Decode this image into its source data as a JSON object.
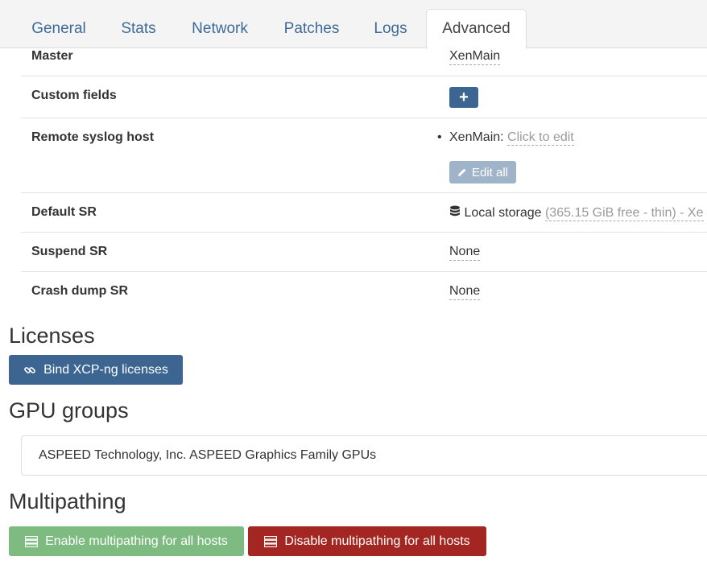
{
  "tabs": [
    {
      "label": "General"
    },
    {
      "label": "Stats"
    },
    {
      "label": "Network"
    },
    {
      "label": "Patches"
    },
    {
      "label": "Logs"
    },
    {
      "label": "Advanced",
      "active": true
    }
  ],
  "properties": {
    "master": {
      "label": "Master",
      "value": "XenMain"
    },
    "custom_fields": {
      "label": "Custom fields",
      "add_button": "+"
    },
    "remote_syslog": {
      "label": "Remote syslog host",
      "host": "XenMain:",
      "edit_link": "Click to edit",
      "edit_all_button": "Edit all"
    },
    "default_sr": {
      "label": "Default SR",
      "name": "Local storage",
      "detail": "(365.15 GiB free - thin) - Xe"
    },
    "suspend_sr": {
      "label": "Suspend SR",
      "value": "None"
    },
    "crash_dump_sr": {
      "label": "Crash dump SR",
      "value": "None"
    }
  },
  "licenses": {
    "title": "Licenses",
    "bind_button": "Bind XCP-ng licenses"
  },
  "gpu_groups": {
    "title": "GPU groups",
    "items": [
      "ASPEED Technology, Inc. ASPEED Graphics Family GPUs"
    ]
  },
  "multipathing": {
    "title": "Multipathing",
    "enable_button": "Enable multipathing for all hosts",
    "disable_button": "Disable multipathing for all hosts"
  },
  "colors": {
    "primary": "#3c6591",
    "success": "#7dbb80",
    "danger": "#a32622",
    "link": "#3e6b96"
  },
  "icons": {
    "link": "link-icon",
    "pencil": "pencil-icon",
    "database": "database-icon",
    "server": "server-icon"
  }
}
